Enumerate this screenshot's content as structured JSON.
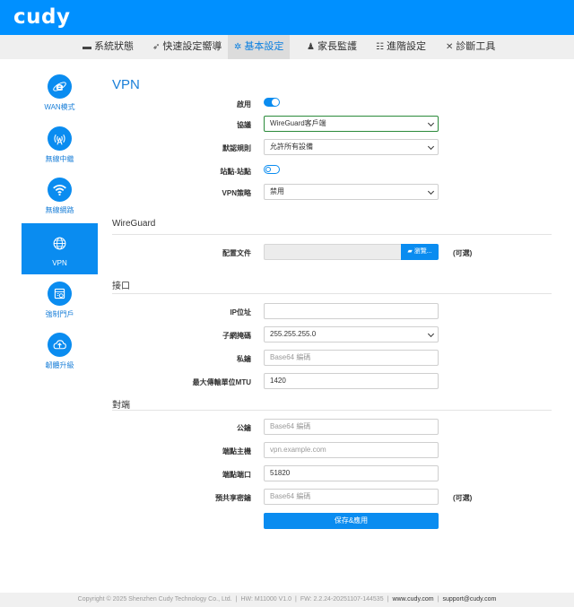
{
  "brand": {
    "logo": "cudy",
    "accent": "#0090ff"
  },
  "nav": {
    "tabs": [
      {
        "label": "系統狀態",
        "icon": "monitor-icon"
      },
      {
        "label": "快速設定嚮導",
        "icon": "rocket-icon"
      },
      {
        "label": "基本設定",
        "icon": "gear-icon",
        "active": true
      },
      {
        "label": "家長監護",
        "icon": "family-icon"
      },
      {
        "label": "進階設定",
        "icon": "sliders-icon"
      },
      {
        "label": "診斷工具",
        "icon": "tools-icon"
      }
    ]
  },
  "sidebar": {
    "items": [
      {
        "label": "WAN模式",
        "icon": "internet-explorer-icon"
      },
      {
        "label": "無線中繼",
        "icon": "wifi-repeater-icon"
      },
      {
        "label": "無線網路",
        "icon": "wifi-icon"
      },
      {
        "label": "VPN",
        "icon": "globe-icon",
        "active": true
      },
      {
        "label": "強制門戶",
        "icon": "portal-icon"
      },
      {
        "label": "韌體升級",
        "icon": "cloud-upload-icon"
      }
    ]
  },
  "vpn": {
    "title": "VPN",
    "enable_label": "啟用",
    "enable_on": true,
    "protocol_label": "協議",
    "protocol_value": "WireGuard客戶端",
    "default_rule_label": "默認規則",
    "default_rule_value": "允許所有設備",
    "site_to_site_label": "站點-站點",
    "site_to_site_on": false,
    "policy_label": "VPN策略",
    "policy_value": "禁用"
  },
  "wireguard": {
    "title": "WireGuard",
    "config_label": "配置文件",
    "browse_label": "瀏覽...",
    "optional": "(可選)"
  },
  "interface": {
    "title": "接口",
    "ip_label": "IP位址",
    "ip_value": "",
    "mask_label": "子網掩碼",
    "mask_value": "255.255.255.0",
    "private_key_label": "私鑰",
    "private_key_placeholder": "Base64 編碼",
    "mtu_label": "最大傳輸單位MTU",
    "mtu_value": "1420"
  },
  "peer": {
    "title": "對端",
    "public_key_label": "公鑰",
    "public_key_placeholder": "Base64 編碼",
    "endpoint_host_label": "端點主機",
    "endpoint_host_placeholder": "vpn.example.com",
    "endpoint_port_label": "端點端口",
    "endpoint_port_value": "51820",
    "psk_label": "預共享密鑰",
    "psk_placeholder": "Base64 編碼",
    "optional": "(可選)"
  },
  "actions": {
    "save_label": "保存&應用"
  },
  "footer": {
    "copyright": "Copyright © 2025 Shenzhen Cudy Technology Co., Ltd.",
    "hw": "HW: M11000 V1.0",
    "fw": "FW: 2.2.24-20251107-144535",
    "site": "www.cudy.com",
    "email": "support@cudy.com"
  }
}
